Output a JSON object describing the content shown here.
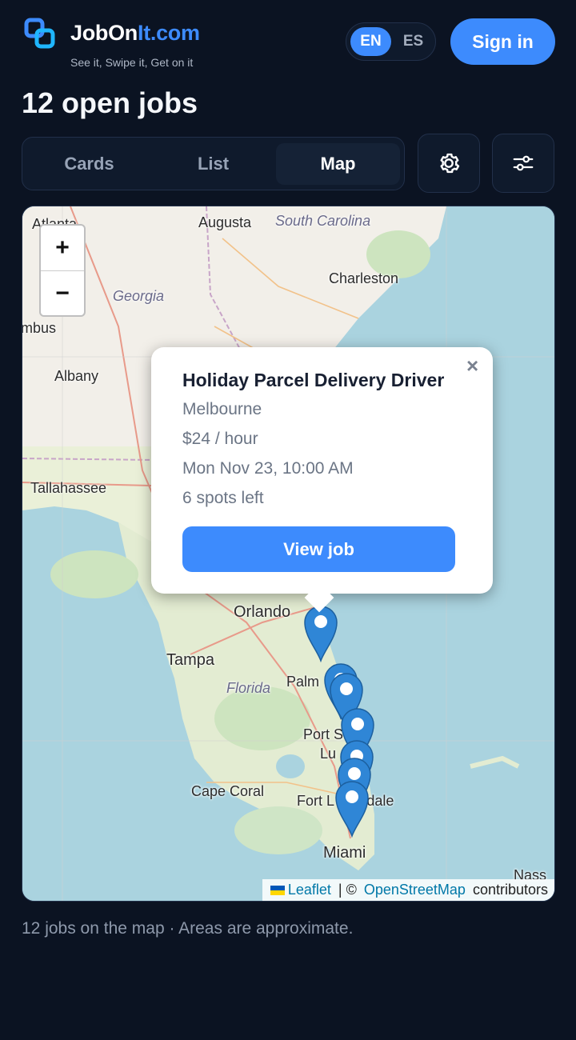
{
  "header": {
    "brand_part1": "JobOn",
    "brand_part2": "It.com",
    "tagline": "See it, Swipe it, Get on it",
    "lang_en": "EN",
    "lang_es": "ES",
    "signin_label": "Sign in",
    "accent": "#3d8bfd"
  },
  "page_title": "12 open jobs",
  "view_tabs": [
    {
      "label": "Cards",
      "active": false
    },
    {
      "label": "List",
      "active": false
    },
    {
      "label": "Map",
      "active": true
    }
  ],
  "toolbar_icons": [
    "gear-icon",
    "sliders-icon"
  ],
  "map": {
    "zoom_in": "+",
    "zoom_out": "−",
    "labels": {
      "atlanta": "Atlanta",
      "augusta": "Augusta",
      "south_carolina": "South Carolina",
      "georgia": "Georgia",
      "charleston": "Charleston",
      "columbus": "mbus",
      "albany": "Albany",
      "tallahassee": "Tallahassee",
      "orlando": "Orlando",
      "tampa": "Tampa",
      "florida": "Florida",
      "palm": "Palm",
      "port": "Port S",
      "lu": "Lu",
      "cape_coral": "Cape Coral",
      "fort_lauderdale": "Fort L     erdale",
      "miami": "Miami",
      "nassau": "Nass"
    },
    "attribution": {
      "leaflet": "Leaflet",
      "separator": " | © ",
      "osm": "OpenStreetMap",
      "contributors": " contributors"
    },
    "marker_count": 7,
    "marker_color": "#2f86d6"
  },
  "popup": {
    "close": "×",
    "title": "Holiday Parcel Delivery Driver",
    "location": "Melbourne",
    "pay": "$24 / hour",
    "datetime": "Mon Nov 23, 10:00 AM",
    "spots": "6 spots left",
    "cta": "View job"
  },
  "footer_note": "12 jobs on the map · Areas are approximate."
}
